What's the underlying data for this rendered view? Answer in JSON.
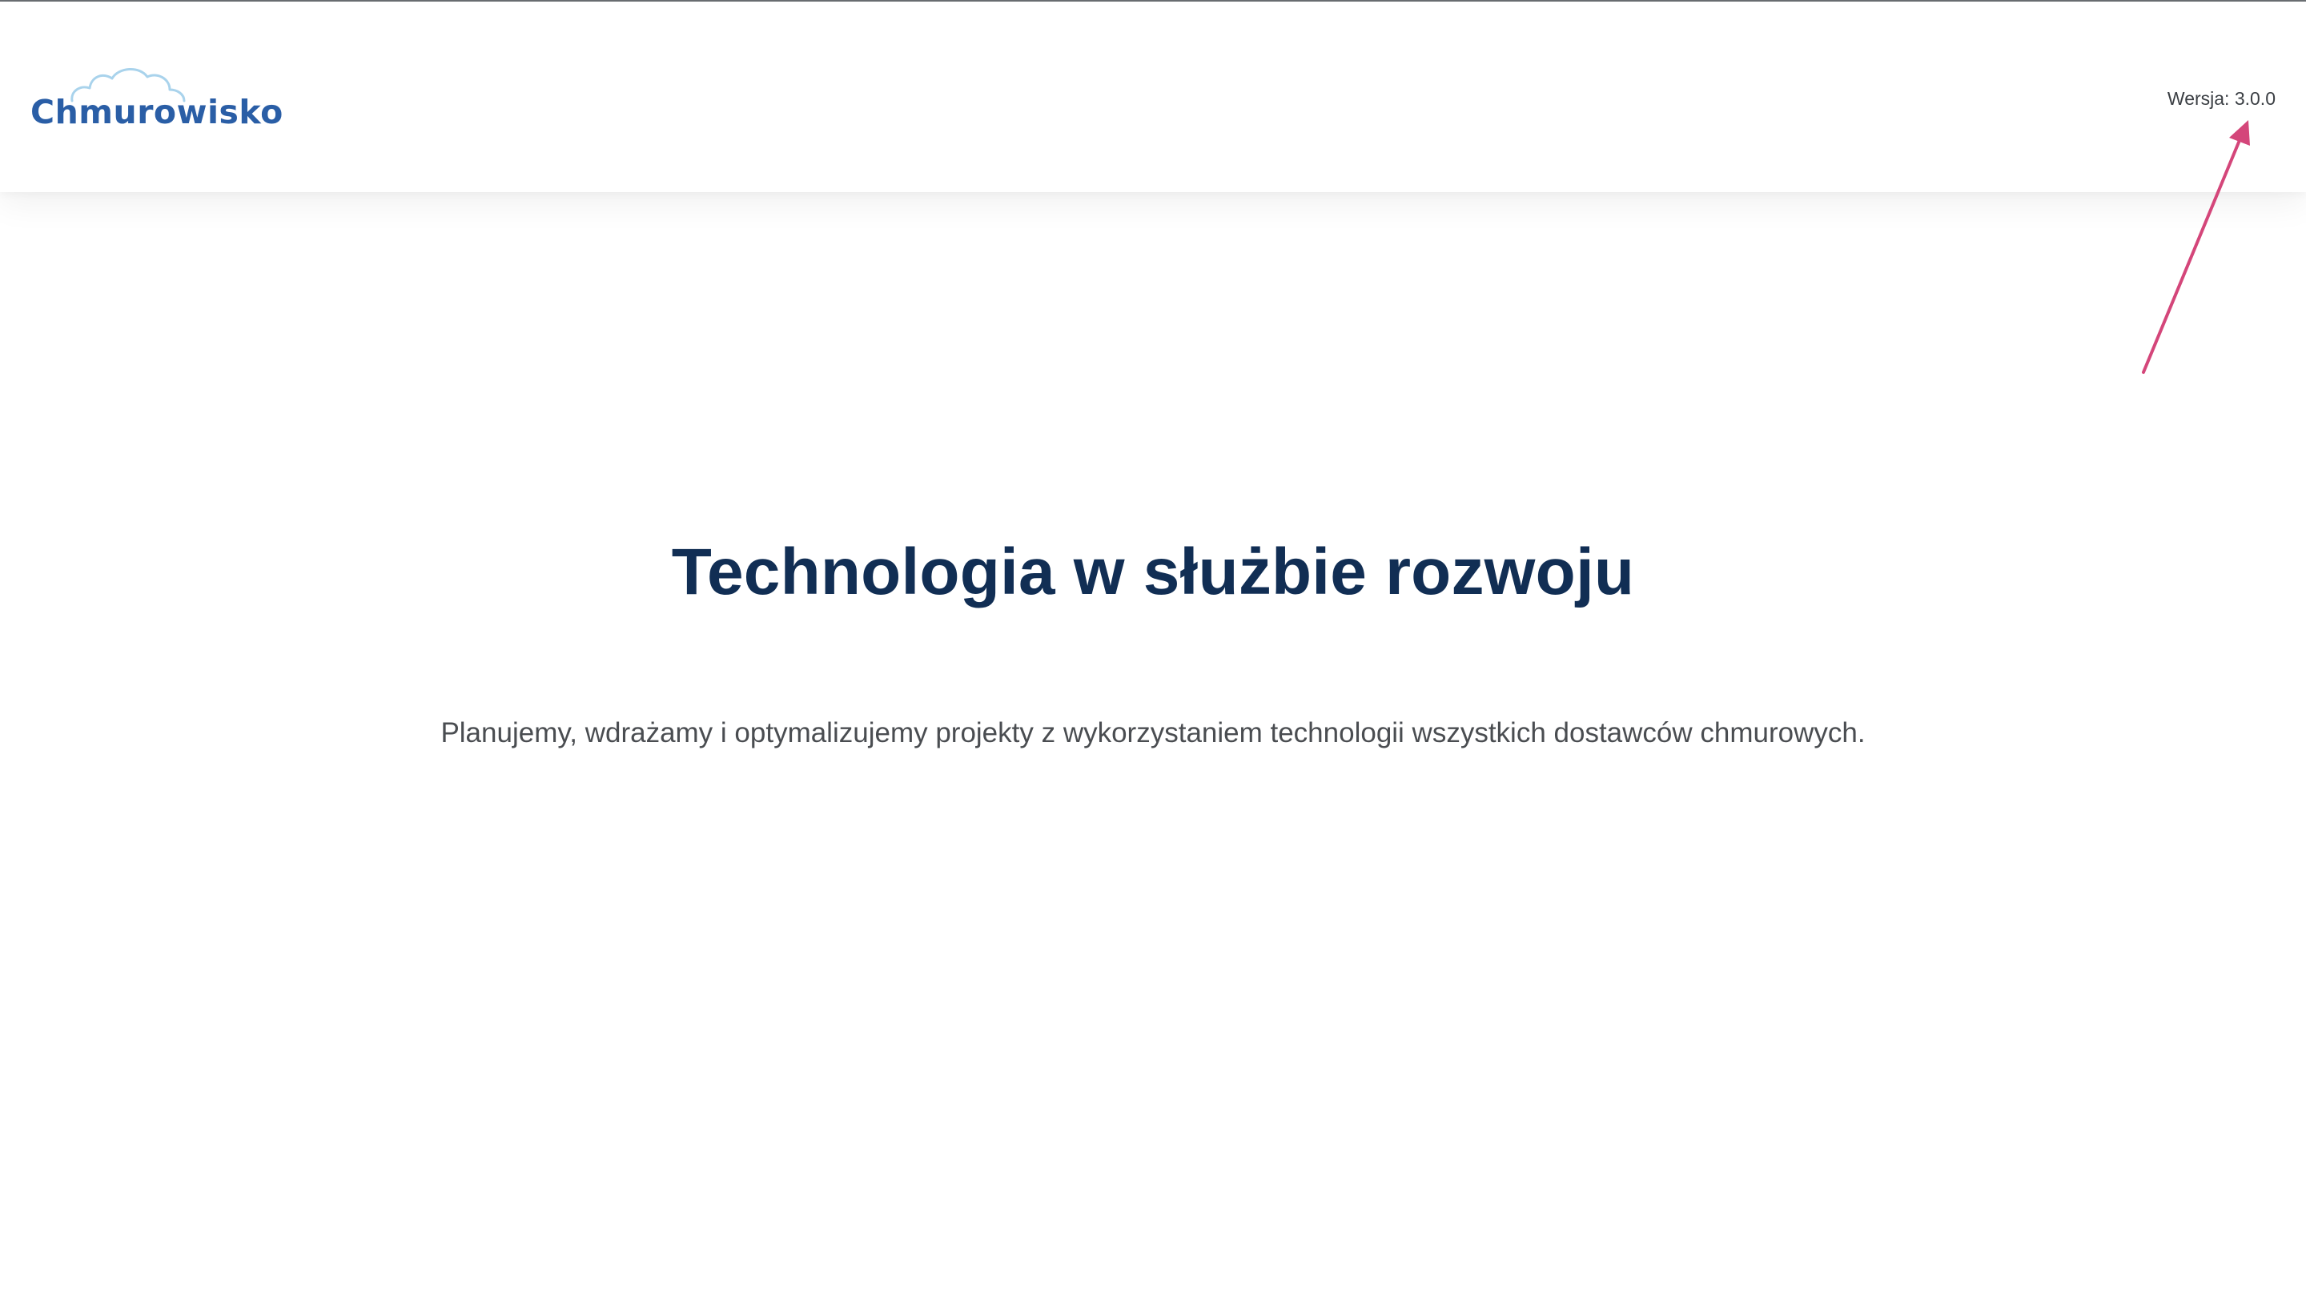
{
  "header": {
    "logo_text": "Chmurowisko",
    "logo_icon": "cloud-icon",
    "version_label": "Wersja: 3.0.0"
  },
  "annotation": {
    "icon": "arrow-icon",
    "color": "#d4467a"
  },
  "hero": {
    "title": "Technologia w służbie rozwoju",
    "subtitle": "Planujemy, wdrażamy i optymalizujemy projekty z wykorzystaniem technologii wszystkich dostawców chmurowych."
  },
  "colors": {
    "brand": "#2a5ea6",
    "cloud": "#a9d3ec",
    "title": "#112e54",
    "text": "#4a4d51"
  }
}
